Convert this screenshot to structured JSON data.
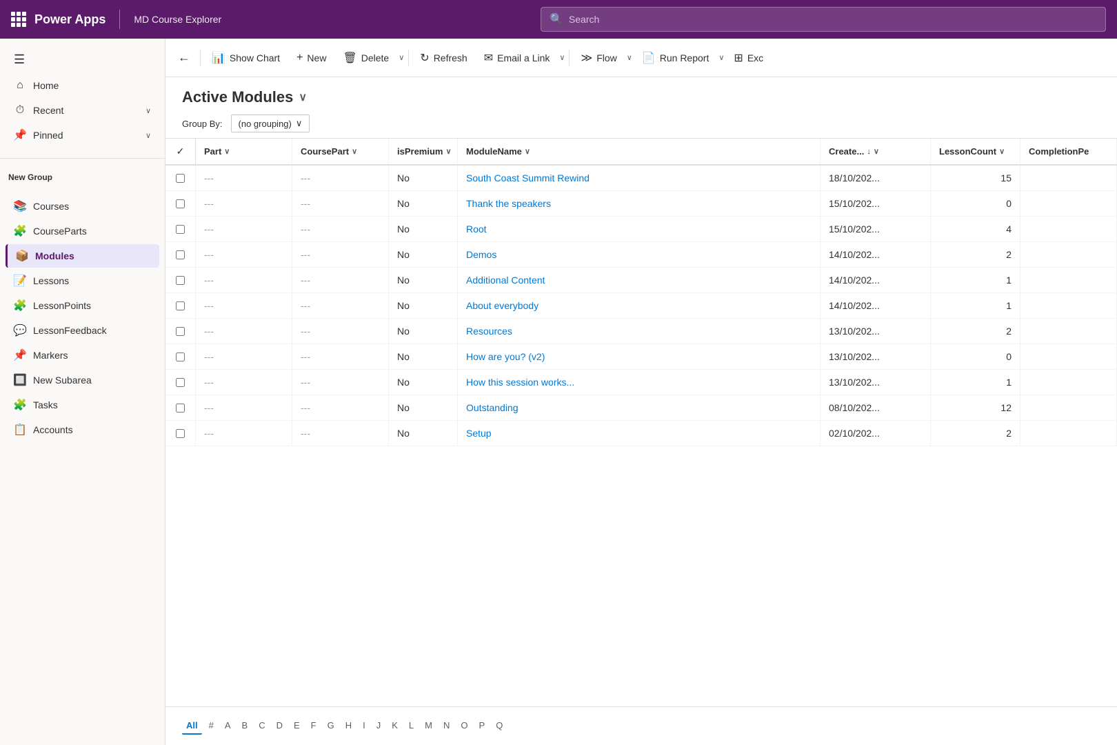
{
  "header": {
    "app_title": "Power Apps",
    "app_subtitle": "MD Course Explorer",
    "search_placeholder": "Search"
  },
  "sidebar": {
    "menu_icon": "≡",
    "items": [
      {
        "id": "home",
        "label": "Home",
        "icon": "⌂"
      },
      {
        "id": "recent",
        "label": "Recent",
        "icon": "⏱",
        "has_chevron": true
      },
      {
        "id": "pinned",
        "label": "Pinned",
        "icon": "📌",
        "has_chevron": true
      }
    ],
    "new_group_label": "New Group",
    "group_items": [
      {
        "id": "courses",
        "label": "Courses",
        "icon": "📚"
      },
      {
        "id": "courseparts",
        "label": "CourseParts",
        "icon": "🧩"
      },
      {
        "id": "modules",
        "label": "Modules",
        "icon": "📦",
        "active": true
      },
      {
        "id": "lessons",
        "label": "Lessons",
        "icon": "📝"
      },
      {
        "id": "lessonpoints",
        "label": "LessonPoints",
        "icon": "🧩"
      },
      {
        "id": "lessonfeedback",
        "label": "LessonFeedback",
        "icon": "💬"
      },
      {
        "id": "markers",
        "label": "Markers",
        "icon": "📌"
      },
      {
        "id": "newsubarea",
        "label": "New Subarea",
        "icon": "🔲"
      },
      {
        "id": "tasks",
        "label": "Tasks",
        "icon": "🧩"
      },
      {
        "id": "accounts",
        "label": "Accounts",
        "icon": "📋"
      }
    ]
  },
  "command_bar": {
    "back_icon": "←",
    "show_chart_label": "Show Chart",
    "new_label": "New",
    "delete_label": "Delete",
    "refresh_label": "Refresh",
    "email_link_label": "Email a Link",
    "flow_label": "Flow",
    "run_report_label": "Run Report",
    "excel_label": "Exc"
  },
  "view": {
    "title": "Active Modules",
    "group_by_label": "Group By:",
    "group_by_value": "(no grouping)"
  },
  "grid": {
    "columns": [
      {
        "id": "part",
        "label": "Part",
        "has_sort": true
      },
      {
        "id": "coursepart",
        "label": "CoursePart",
        "has_sort": true
      },
      {
        "id": "ispremium",
        "label": "isPremium",
        "has_sort": true
      },
      {
        "id": "modulename",
        "label": "ModuleName",
        "has_sort": true
      },
      {
        "id": "created",
        "label": "Create...",
        "has_sort": true,
        "sort_active": true
      },
      {
        "id": "lessoncount",
        "label": "LessonCount",
        "has_sort": true
      },
      {
        "id": "completionpe",
        "label": "CompletionPe",
        "has_sort": false
      }
    ],
    "rows": [
      {
        "part": "---",
        "coursepart": "---",
        "ispremium": "No",
        "modulename": "South Coast Summit Rewind",
        "created": "18/10/202...",
        "lessoncount": "15",
        "completionpe": ""
      },
      {
        "part": "---",
        "coursepart": "---",
        "ispremium": "No",
        "modulename": "Thank the speakers",
        "created": "15/10/202...",
        "lessoncount": "0",
        "completionpe": ""
      },
      {
        "part": "---",
        "coursepart": "---",
        "ispremium": "No",
        "modulename": "Root",
        "created": "15/10/202...",
        "lessoncount": "4",
        "completionpe": ""
      },
      {
        "part": "---",
        "coursepart": "---",
        "ispremium": "No",
        "modulename": "Demos",
        "created": "14/10/202...",
        "lessoncount": "2",
        "completionpe": ""
      },
      {
        "part": "---",
        "coursepart": "---",
        "ispremium": "No",
        "modulename": "Additional Content",
        "created": "14/10/202...",
        "lessoncount": "1",
        "completionpe": ""
      },
      {
        "part": "---",
        "coursepart": "---",
        "ispremium": "No",
        "modulename": "About everybody",
        "created": "14/10/202...",
        "lessoncount": "1",
        "completionpe": ""
      },
      {
        "part": "---",
        "coursepart": "---",
        "ispremium": "No",
        "modulename": "Resources",
        "created": "13/10/202...",
        "lessoncount": "2",
        "completionpe": ""
      },
      {
        "part": "---",
        "coursepart": "---",
        "ispremium": "No",
        "modulename": "How are you? (v2)",
        "created": "13/10/202...",
        "lessoncount": "0",
        "completionpe": ""
      },
      {
        "part": "---",
        "coursepart": "---",
        "ispremium": "No",
        "modulename": "How this session works...",
        "created": "13/10/202...",
        "lessoncount": "1",
        "completionpe": ""
      },
      {
        "part": "---",
        "coursepart": "---",
        "ispremium": "No",
        "modulename": "Outstanding",
        "created": "08/10/202...",
        "lessoncount": "12",
        "completionpe": ""
      },
      {
        "part": "---",
        "coursepart": "---",
        "ispremium": "No",
        "modulename": "Setup",
        "created": "02/10/202...",
        "lessoncount": "2",
        "completionpe": ""
      }
    ]
  },
  "pagination": {
    "labels": [
      "All",
      "#",
      "A",
      "B",
      "C",
      "D",
      "E",
      "F",
      "G",
      "H",
      "I",
      "J",
      "K",
      "L",
      "M",
      "N",
      "O",
      "P",
      "Q"
    ],
    "active": "All"
  },
  "colors": {
    "primary": "#5c1a6b",
    "active_nav": "#e8e6f8",
    "border": "#e1dfdd"
  }
}
